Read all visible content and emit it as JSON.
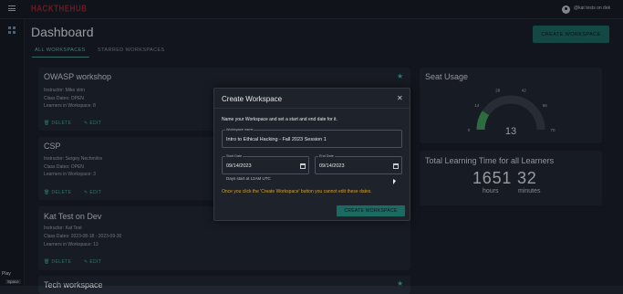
{
  "header": {
    "logo_text": "HACKTHEHUB",
    "user_name": "@kat tests on dek"
  },
  "sidebar": {
    "play_label": "Play",
    "space_label": "Space"
  },
  "page": {
    "title": "Dashboard",
    "create_button_label": "CREATE WORKSPACE",
    "tabs": [
      {
        "label": "ALL WORKSPACES",
        "active": true
      },
      {
        "label": "STARRED WORKSPACES",
        "active": false
      }
    ]
  },
  "workspaces": [
    {
      "title": "OWASP workshop",
      "instructor": "Instructor: Mike strin",
      "class_dates": "Class Dates: OPEN",
      "learners": "Learners in Workspace: 8",
      "starred": true,
      "delete_label": "DELETE",
      "edit_label": "EDIT"
    },
    {
      "title": "CSP",
      "instructor": "Instructor: Sergey Nechmilov",
      "class_dates": "Class Dates: OPEN",
      "learners": "Learners in Workspace: 3",
      "starred": false,
      "delete_label": "DELETE",
      "edit_label": "EDIT"
    },
    {
      "title": "Kat Test on Dev",
      "instructor": "Instructor: Kat Test",
      "class_dates": "Class Dates: 2023-08-18 - 2023-09-30",
      "learners": "Learners in Workspace: 13",
      "starred": false,
      "delete_label": "DELETE",
      "edit_label": "EDIT"
    },
    {
      "title": "Tech workspace",
      "starred": true
    }
  ],
  "seat_usage": {
    "title": "Seat Usage",
    "value": 13,
    "max": 70,
    "tick_labels": [
      "0",
      "14",
      "28",
      "42",
      "56",
      "70"
    ],
    "accent_color": "#3fa35a",
    "track_color": "#3a414b"
  },
  "learning_time": {
    "title": "Total Learning Time for all Learners",
    "hours": "1651",
    "minutes": "32",
    "hours_label": "hours",
    "minutes_label": "minutes"
  },
  "modal": {
    "title": "Create Workspace",
    "description": "Name your Workspace and set a start and end date for it.",
    "name_label": "Workspace name",
    "name_value": "Intro to Ethical Hacking - Fall 2023 Session 1",
    "start_label": "Start Date",
    "start_value": "09/14/2023",
    "end_label": "End Date",
    "end_value": "09/14/2023",
    "helper_text": "Days start at 12AM UTC",
    "warning_text": "Once you click the 'Create Workspace' button you cannot edit these dates.",
    "submit_label": "CREATE WORKSPACE",
    "warning_color": "#d9a02a"
  },
  "colors": {
    "accent": "#1b6b63",
    "accent_text": "#3fb59e",
    "background": "#181d25",
    "card": "#1f252e",
    "brand": "#a3232b"
  }
}
